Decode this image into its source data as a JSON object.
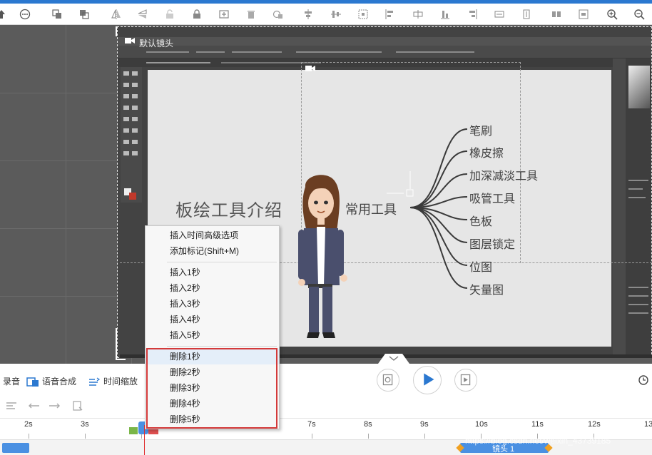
{
  "canvas": {
    "camera_label": "默认镜头",
    "mindmap": {
      "title": "板绘工具介绍",
      "center": "常用工具",
      "branches": [
        "笔刷",
        "橡皮擦",
        "加深减淡工具",
        "吸管工具",
        "色板",
        "图层锁定",
        "位图",
        "矢量图"
      ]
    }
  },
  "bottom": {
    "actions": [
      {
        "label": "录音",
        "icon": "microphone-icon"
      },
      {
        "label": "语音合成",
        "icon": "tts-icon"
      },
      {
        "label": "时间缩放",
        "icon": "time-scale-icon"
      }
    ],
    "ruler_ticks": [
      "2s",
      "3s",
      "7s",
      "8s",
      "9s",
      "10s",
      "11s",
      "12s",
      "13"
    ],
    "track_label": "镜头 1",
    "watermark": "https://blog.csdn.net/weixin_43739185"
  },
  "context_menu": {
    "top_items": [
      "插入时间高级选项",
      "添加标记(Shift+M)"
    ],
    "insert_items": [
      "插入1秒",
      "插入2秒",
      "插入3秒",
      "插入4秒",
      "插入5秒"
    ],
    "delete_items": [
      "删除1秒",
      "删除2秒",
      "删除3秒",
      "删除4秒",
      "删除5秒"
    ]
  },
  "colors": {
    "accent": "#2b78d0",
    "highlight_box": "#d43a3a",
    "track_clip": "#4a90e2",
    "playhead": "#e03030"
  }
}
